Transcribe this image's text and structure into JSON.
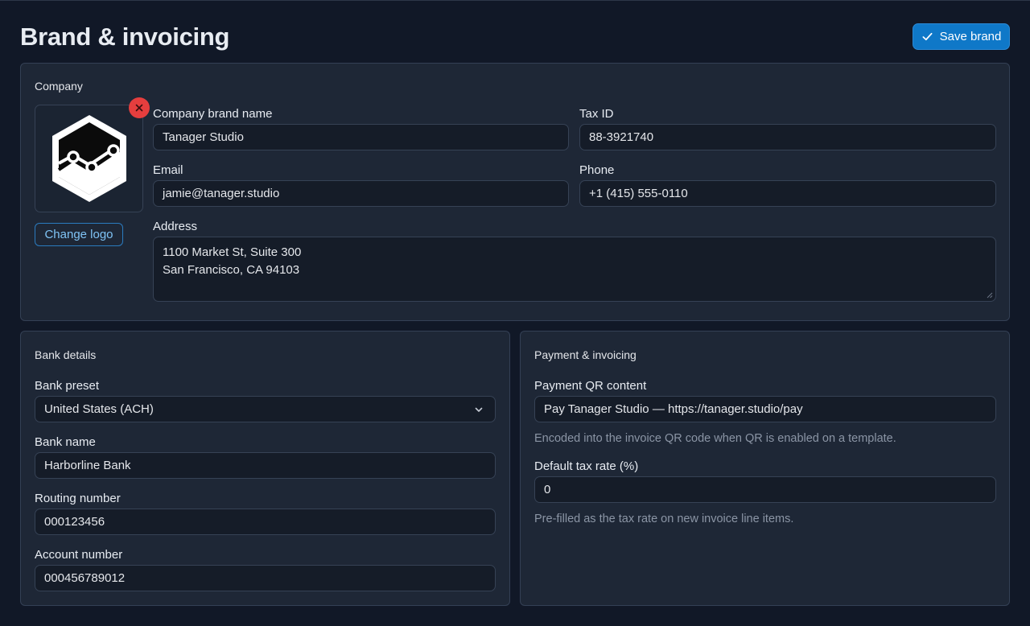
{
  "header": {
    "title": "Brand & invoicing",
    "save_label": "Save brand"
  },
  "company": {
    "section_title": "Company",
    "change_logo_label": "Change logo",
    "brand_name_label": "Company brand name",
    "brand_name_value": "Tanager Studio",
    "tax_id_label": "Tax ID",
    "tax_id_value": "88-3921740",
    "email_label": "Email",
    "email_value": "jamie@tanager.studio",
    "phone_label": "Phone",
    "phone_value": "+1 (415) 555-0110",
    "address_label": "Address",
    "address_lines": [
      "1100 Market St, Suite 300",
      "San Francisco, CA 94103"
    ]
  },
  "bank": {
    "section_title": "Bank details",
    "preset_label": "Bank preset",
    "preset_value": "United States (ACH)",
    "bank_name_label": "Bank name",
    "bank_name_value": "Harborline Bank",
    "routing_label": "Routing number",
    "routing_value": "000123456",
    "account_label": "Account number",
    "account_value": "000456789012"
  },
  "payment": {
    "section_title": "Payment & invoicing",
    "qr_label": "Payment QR content",
    "qr_value": "Pay Tanager Studio — https://tanager.studio/pay",
    "qr_hint": "Encoded into the invoice QR code when QR is enabled on a template.",
    "tax_rate_label": "Default tax rate (%)",
    "tax_rate_value": "0",
    "tax_rate_hint": "Pre-filled as the tax rate on new invoice line items."
  },
  "icons": {
    "save": "check-icon",
    "remove_logo": "close-icon",
    "logo": "chart-hexagon-logo",
    "select": "chevron-down-icon"
  },
  "colors": {
    "accent": "#0f78c8",
    "danger": "#e53e3e",
    "link": "#7fc3f5"
  }
}
